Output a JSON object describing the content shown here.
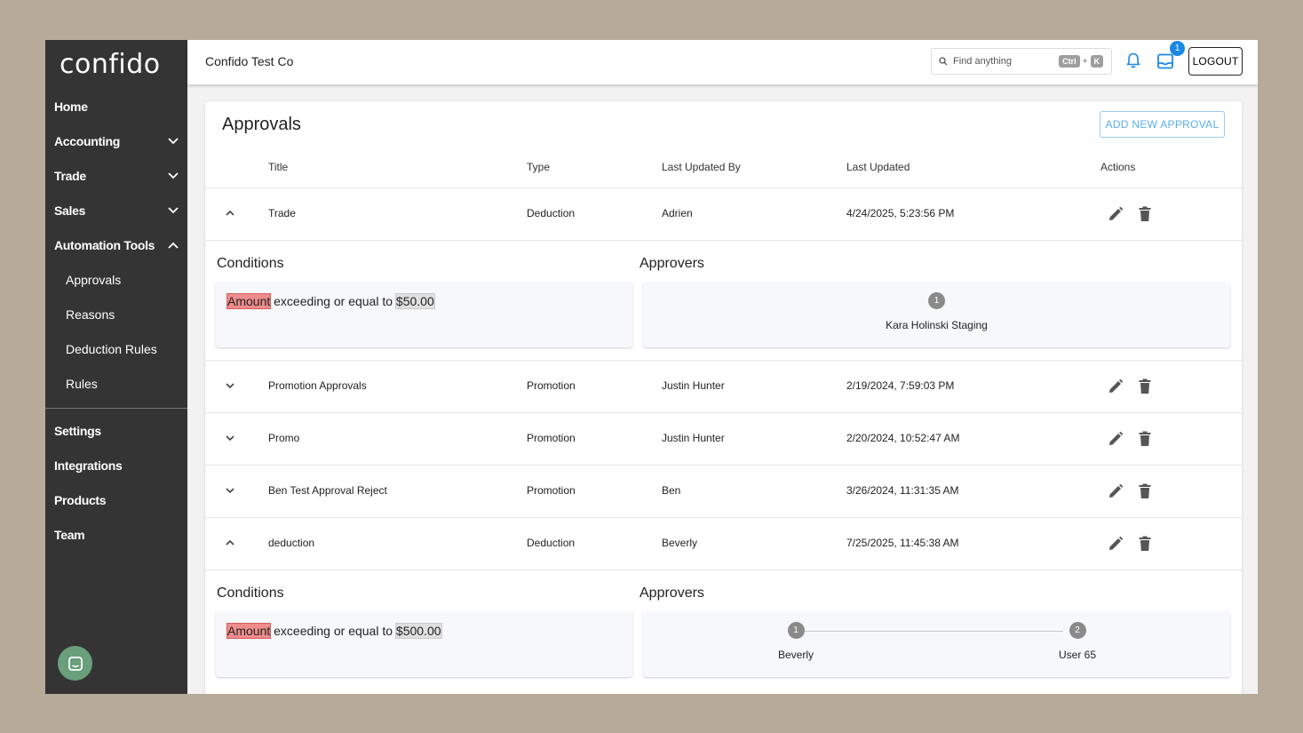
{
  "sidebar": {
    "logo": "confido",
    "items": [
      {
        "label": "Home"
      },
      {
        "label": "Accounting"
      },
      {
        "label": "Trade"
      },
      {
        "label": "Sales"
      },
      {
        "label": "Automation Tools"
      }
    ],
    "subitems": [
      {
        "label": "Approvals"
      },
      {
        "label": "Reasons"
      },
      {
        "label": "Deduction Rules"
      },
      {
        "label": "Rules"
      }
    ],
    "bottom_items": [
      {
        "label": "Settings"
      },
      {
        "label": "Integrations"
      },
      {
        "label": "Products"
      },
      {
        "label": "Team"
      }
    ]
  },
  "header": {
    "company": "Confido Test Co",
    "search_placeholder": "Find anything",
    "shortcut_ctrl": "Ctrl",
    "shortcut_plus": "+",
    "shortcut_key": "K",
    "inbox_count": "1",
    "logout_label": "LOGOUT",
    "accent": "#1a88e6"
  },
  "page": {
    "title": "Approvals",
    "add_button": "ADD NEW APPROVAL",
    "columns": {
      "title": "Title",
      "type": "Type",
      "updated_by": "Last Updated By",
      "updated": "Last Updated",
      "actions": "Actions"
    },
    "rows": [
      {
        "title": "Trade",
        "type": "Deduction",
        "updated_by": "Adrien",
        "updated": "4/24/2025, 5:23:56 PM",
        "expanded": true
      },
      {
        "title": "Promotion Approvals",
        "type": "Promotion",
        "updated_by": "Justin Hunter",
        "updated": "2/19/2024, 7:59:03 PM",
        "expanded": false
      },
      {
        "title": "Promo",
        "type": "Promotion",
        "updated_by": "Justin Hunter",
        "updated": "2/20/2024, 10:52:47 AM",
        "expanded": false
      },
      {
        "title": "Ben Test Approval Reject",
        "type": "Promotion",
        "updated_by": "Ben",
        "updated": "3/26/2024, 11:31:35 AM",
        "expanded": false
      },
      {
        "title": "deduction",
        "type": "Deduction",
        "updated_by": "Beverly",
        "updated": "7/25/2025, 11:45:38 AM",
        "expanded": true
      }
    ],
    "details": [
      {
        "conditions_label": "Conditions",
        "approvers_label": "Approvers",
        "condition": {
          "field": "Amount",
          "operator": "exceeding or equal to",
          "value": "$50.00"
        },
        "approvers": [
          {
            "step": "1",
            "name": "Kara Holinski Staging"
          }
        ]
      },
      {
        "conditions_label": "Conditions",
        "approvers_label": "Approvers",
        "condition": {
          "field": "Amount",
          "operator": "exceeding or equal to",
          "value": "$500.00"
        },
        "approvers": [
          {
            "step": "1",
            "name": "Beverly"
          },
          {
            "step": "2",
            "name": "User 65"
          }
        ]
      }
    ]
  },
  "icons": {
    "chevron": "chevron-down-icon",
    "edit": "pencil-icon",
    "delete": "trash-icon",
    "bell": "bell-icon",
    "inbox": "inbox-icon",
    "search": "search-icon",
    "chat": "chat-icon"
  }
}
